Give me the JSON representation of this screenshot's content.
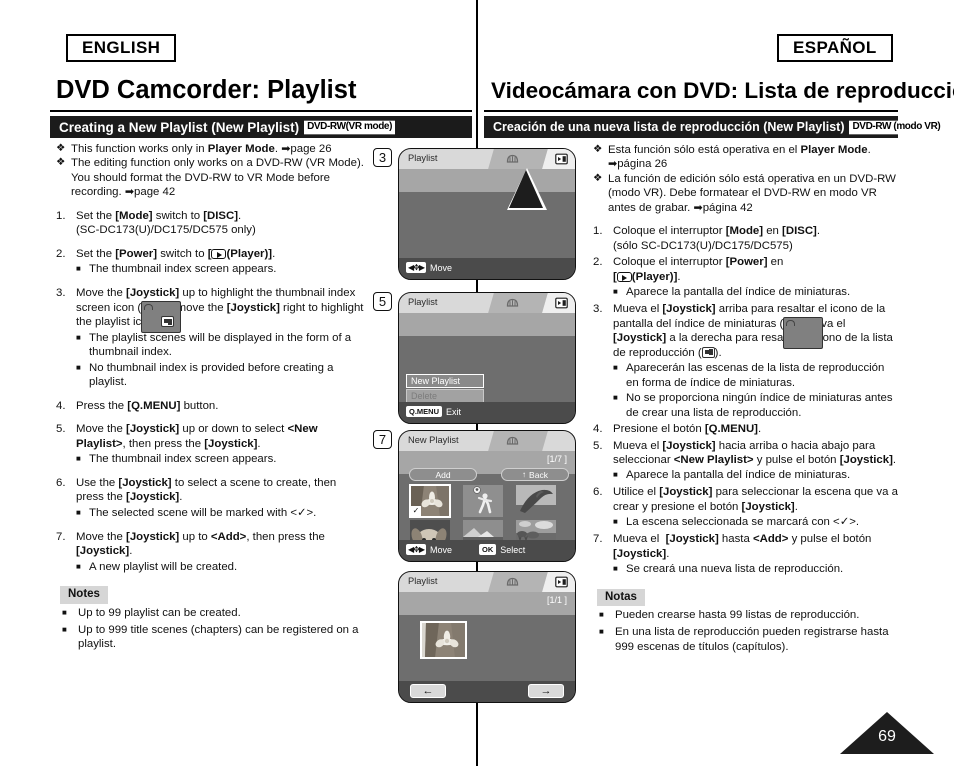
{
  "meta": {
    "lang_en": "ENGLISH",
    "lang_es": "ESPAÑOL",
    "page_number": "69"
  },
  "english": {
    "title": "DVD Camcorder: Playlist",
    "section_header": "Creating a New Playlist (New Playlist)",
    "section_badge": "DVD-RW(VR mode)",
    "bullets": [
      "This function works only in Player Mode. ➡page 26",
      "The editing function only works on a DVD-RW (VR Mode). You should format the DVD-RW to VR Mode before recording. ➡page 42"
    ],
    "steps": [
      {
        "n": "1.",
        "text": "Set the [Mode] switch to [DISC]. (SC-DC173(U)/DC175/DC575 only)",
        "subs": []
      },
      {
        "n": "2.",
        "text": "Set the [Power] switch to [(Player)].",
        "subs": [
          "The thumbnail index screen appears."
        ]
      },
      {
        "n": "3.",
        "text": "Move the [Joystick] up to highlight the thumbnail index screen icon ( ), then move the [Joystick] right to highlight the playlist icon ( ).",
        "subs": [
          "The playlist scenes will be displayed in the form of a thumbnail index.",
          "No thumbnail index is provided before creating a playlist."
        ]
      },
      {
        "n": "4.",
        "text": "Press the [Q.MENU] button.",
        "subs": []
      },
      {
        "n": "5.",
        "text": "Move the [Joystick] up or down to select <New Playlist>, then press the [Joystick].",
        "subs": [
          "The thumbnail index screen appears."
        ]
      },
      {
        "n": "6.",
        "text": "Use the [Joystick] to select a scene to create, then press the [Joystick].",
        "subs": [
          "The selected scene will be marked with <✓>."
        ]
      },
      {
        "n": "7.",
        "text": "Move the [Joystick] up to <Add>, then press the [Joystick].",
        "subs": [
          "A new playlist will be created."
        ]
      }
    ],
    "notes_label": "Notes",
    "notes": [
      "Up to 99 playlist can be created.",
      "Up to 999 title scenes (chapters) can be registered on a playlist."
    ]
  },
  "spanish": {
    "title": "Videocámara con DVD: Lista de reproducción",
    "section_header": "Creación de una nueva lista de reproducción (New Playlist)",
    "section_badge": "DVD-RW (modo VR)",
    "bullets": [
      "Esta función sólo está operativa en el Player Mode. ➡página 26",
      "La función de edición sólo está operativa en un DVD-RW (modo VR). Debe formatear el DVD-RW en modo VR antes de grabar. ➡página 42"
    ],
    "steps": [
      {
        "n": "1.",
        "text": "Coloque el interruptor [Mode] en [DISC]. (sólo SC-DC173(U)/DC175/DC575)",
        "subs": []
      },
      {
        "n": "2.",
        "text": "Coloque el interruptor [Power] en [(Player)].",
        "subs": [
          "Aparece la pantalla del índice de miniaturas."
        ]
      },
      {
        "n": "3.",
        "text": "Mueva el [Joystick] arriba para resaltar el icono de la pantalla del índice de miniaturas ( ) y mueva el [Joystick] a la derecha para resaltar el icono de la lista de reproducción ( ).",
        "subs": [
          "Aparecerán las escenas de la lista de reproducción en forma de índice de miniaturas.",
          "No se proporciona ningún índice de miniaturas antes de crear una lista de reproducción."
        ]
      },
      {
        "n": "4.",
        "text": "Presione el botón [Q.MENU].",
        "subs": []
      },
      {
        "n": "5.",
        "text": "Mueva el [Joystick] hacia arriba o hacia abajo para seleccionar <New Playlist> y pulse el botón [Joystick].",
        "subs": [
          "Aparece la pantalla del índice de miniaturas."
        ]
      },
      {
        "n": "6.",
        "text": "Utilice el [Joystick] para seleccionar la escena que va a crear y presione el botón [Joystick].",
        "subs": [
          "La escena seleccionada se marcará con <✓>."
        ]
      },
      {
        "n": "7.",
        "text": "Mueva el  [Joystick] hasta <Add> y pulse el botón [Joystick].",
        "subs": [
          "Se creará una nueva lista de reproducción."
        ]
      }
    ],
    "notes_label": "Notas",
    "notes": [
      "Pueden crearse hasta 99 listas de reproducción.",
      "En una lista de reproducción pueden registrarse hasta 999 escenas de títulos (capítulos)."
    ]
  },
  "screens": [
    {
      "step": "3",
      "title": "Playlist",
      "footer_key": "",
      "footer_label": "Move",
      "icons": [
        "thumbnail-index-icon",
        "playlist-icon"
      ]
    },
    {
      "step": "5",
      "title": "Playlist",
      "menu": [
        {
          "label": "New Playlist",
          "state": "selected"
        },
        {
          "label": "Delete",
          "state": "disabled"
        }
      ],
      "footer_key": "Q.MENU",
      "footer_label": "Exit"
    },
    {
      "step": "7",
      "title": "New Playlist",
      "page_count": "[1/7 ]",
      "add_label": "Add",
      "back_label": "Back",
      "footer_move_label": "Move",
      "footer_ok_key": "OK",
      "footer_ok_label": "Select",
      "thumbnails": [
        {
          "name": "lotus-flower",
          "selected": true,
          "check": "✓"
        },
        {
          "name": "soccer-player",
          "selected": false
        },
        {
          "name": "dolphin",
          "selected": false
        },
        {
          "name": "dog",
          "selected": false
        },
        {
          "name": "mountain-lake",
          "selected": false
        },
        {
          "name": "landscape-field",
          "selected": false
        }
      ]
    },
    {
      "step": "",
      "title": "Playlist",
      "page_count": "[1/1 ]",
      "prev_label": "←",
      "next_label": "→",
      "thumbnails": [
        {
          "name": "lotus-flower",
          "selected": true
        }
      ]
    }
  ],
  "colors": {
    "ink": "#111111",
    "header_bg": "#1b1b1b",
    "notes_bg": "#d6d6d6",
    "lcd_body": "#6e6e6e",
    "lcd_tabbar": "#d9d9d9"
  }
}
